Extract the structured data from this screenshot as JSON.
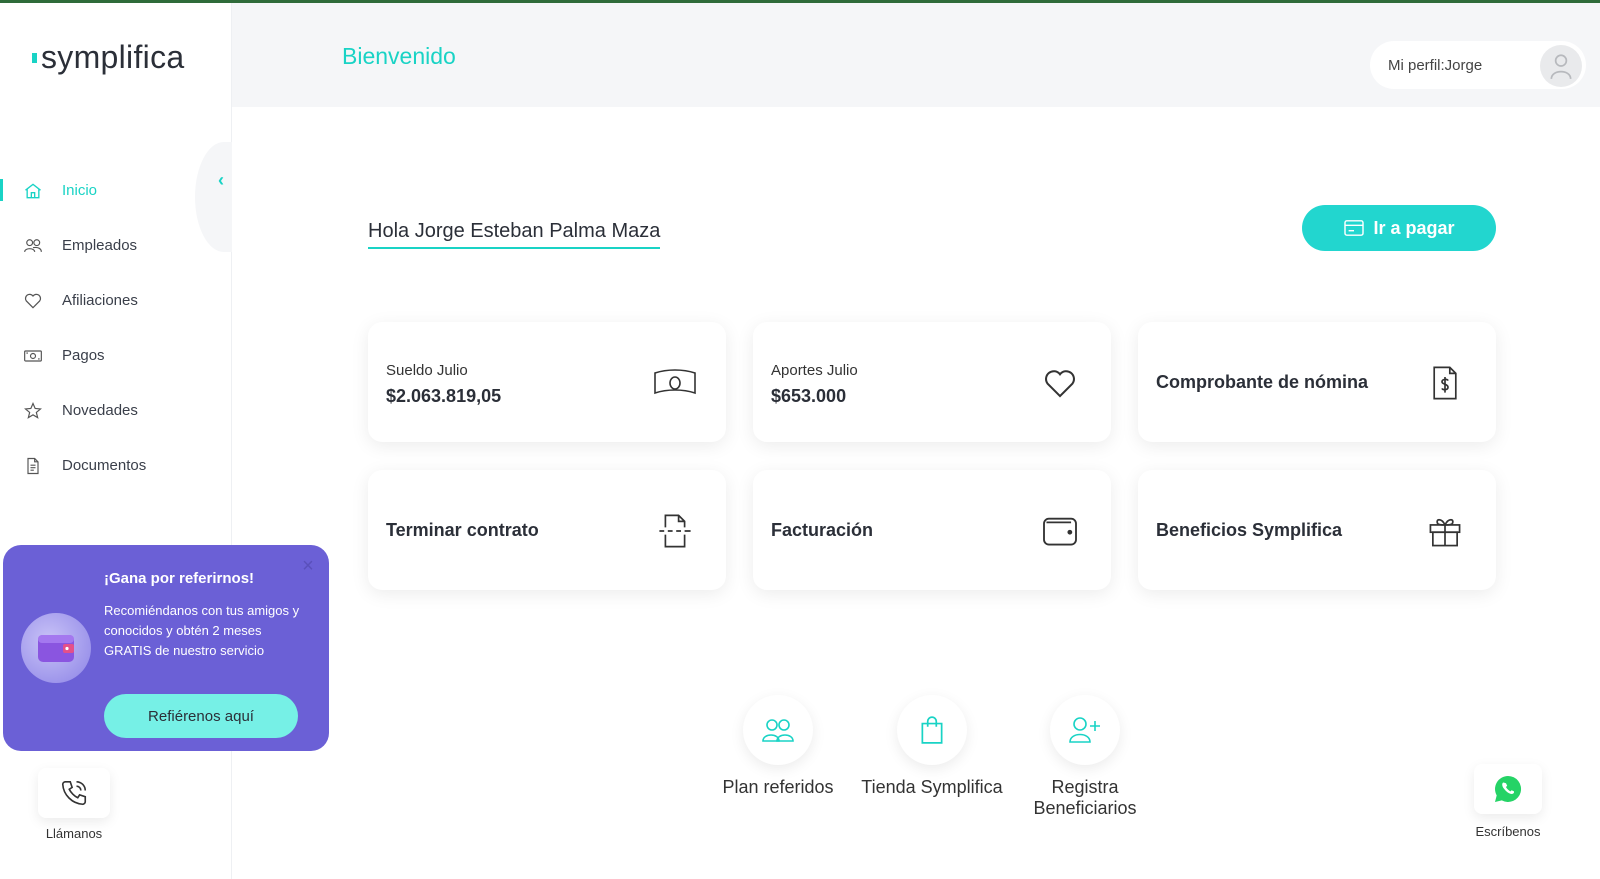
{
  "brand": {
    "name": "symplifica",
    "accent": "#19d3c5"
  },
  "header": {
    "title": "Bienvenido",
    "profile_label": "Mi perfil:Jorge"
  },
  "sidebar": {
    "items": [
      {
        "label": "Inicio",
        "icon": "home-icon",
        "active": true
      },
      {
        "label": "Empleados",
        "icon": "users-icon"
      },
      {
        "label": "Afiliaciones",
        "icon": "heart-icon"
      },
      {
        "label": "Pagos",
        "icon": "money-icon"
      },
      {
        "label": "Novedades",
        "icon": "star-icon"
      },
      {
        "label": "Documentos",
        "icon": "document-icon"
      }
    ]
  },
  "main": {
    "greeting": "Hola Jorge Esteban Palma Maza",
    "pay_button": "Ir a pagar",
    "cards": [
      {
        "label": "Sueldo Julio",
        "value": "$2.063.819,05",
        "icon": "money-icon"
      },
      {
        "label": "Aportes Julio",
        "value": "$653.000",
        "icon": "heart-icon"
      },
      {
        "title": "Comprobante de nómina",
        "icon": "receipt-icon"
      },
      {
        "title": "Terminar contrato",
        "icon": "cut-document-icon"
      },
      {
        "title": "Facturación",
        "icon": "wallet-icon"
      },
      {
        "title": "Beneficios Symplifica",
        "icon": "gift-icon"
      }
    ],
    "quick_links": [
      {
        "label": "Plan referidos",
        "icon": "users-icon"
      },
      {
        "label": "Tienda Symplifica",
        "icon": "shopping-bag-icon"
      },
      {
        "label": "Registra Beneficiarios",
        "icon": "add-user-icon"
      }
    ]
  },
  "promo": {
    "title": "¡Gana por referirnos!",
    "text": "Recomiéndanos con tus amigos y conocidos y obtén 2 meses GRATIS de nuestro servicio",
    "button": "Refiérenos aquí",
    "color": "#6b60d6"
  },
  "contact": {
    "call_label": "Llámanos",
    "whatsapp_label": "Escríbenos"
  }
}
